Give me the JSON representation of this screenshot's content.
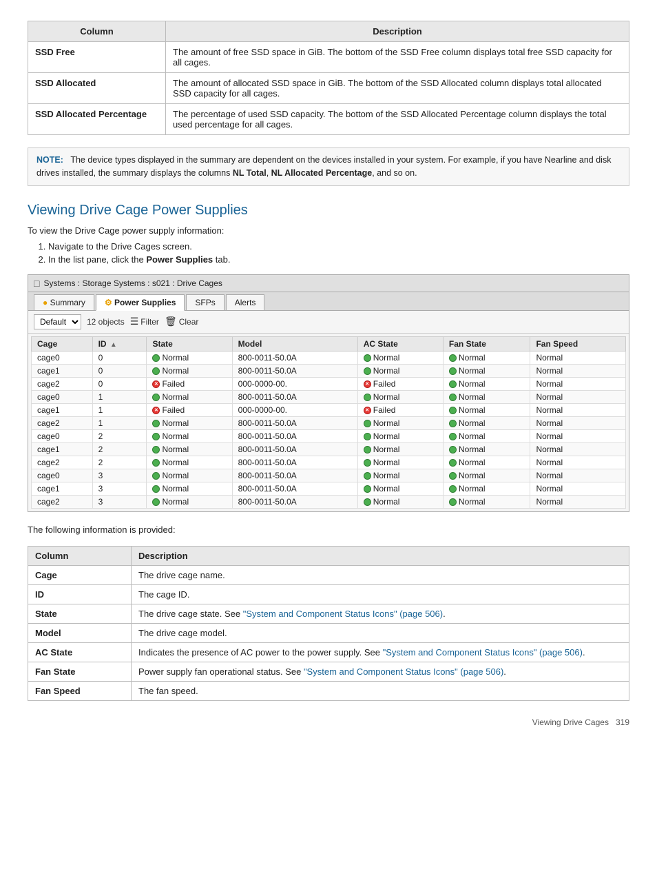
{
  "top_table": {
    "headers": [
      "Column",
      "Description"
    ],
    "rows": [
      {
        "column": "SSD Free",
        "description": "The amount of free SSD space in GiB. The bottom of the SSD Free column displays total free SSD capacity for all cages."
      },
      {
        "column": "SSD Allocated",
        "description": "The amount of allocated SSD space in GiB. The bottom of the SSD Allocated column displays total allocated SSD capacity for all cages."
      },
      {
        "column": "SSD Allocated Percentage",
        "description": "The percentage of used SSD capacity. The bottom of the SSD Allocated Percentage column displays the total used percentage for all cages."
      }
    ]
  },
  "note": {
    "label": "NOTE:",
    "text": "The device types displayed in the summary are dependent on the devices installed in your system. For example, if you have Nearline and disk drives installed, the summary displays the columns NL Total, NL Allocated Percentage, and so on."
  },
  "section": {
    "heading": "Viewing Drive Cage Power Supplies",
    "intro": "To view the Drive Cage power supply information:",
    "steps": [
      "Navigate to the Drive Cages screen.",
      "In the list pane, click the Power Supplies tab."
    ]
  },
  "ui": {
    "titlebar": "Systems : Storage Systems : s021 : Drive Cages",
    "tabs": [
      "Summary",
      "Power Supplies",
      "SFPs",
      "Alerts"
    ],
    "active_tab": "Power Supplies",
    "toolbar": {
      "dropdown_value": "Default",
      "objects_count": "12 objects",
      "filter_label": "Filter",
      "clear_label": "Clear"
    },
    "table_headers": [
      "Cage",
      "ID",
      "State",
      "Model",
      "AC State",
      "Fan State",
      "Fan Speed"
    ],
    "rows": [
      {
        "cage": "cage0",
        "id": "0",
        "state": "Normal",
        "state_type": "normal",
        "model": "800-0011-50.0A",
        "ac_state": "Normal",
        "ac_type": "normal",
        "fan_state": "Normal",
        "fan_type": "normal",
        "fan_speed": "Normal"
      },
      {
        "cage": "cage1",
        "id": "0",
        "state": "Normal",
        "state_type": "normal",
        "model": "800-0011-50.0A",
        "ac_state": "Normal",
        "ac_type": "normal",
        "fan_state": "Normal",
        "fan_type": "normal",
        "fan_speed": "Normal"
      },
      {
        "cage": "cage2",
        "id": "0",
        "state": "Failed",
        "state_type": "failed",
        "model": "000-0000-00.",
        "ac_state": "Failed",
        "ac_type": "failed",
        "fan_state": "Normal",
        "fan_type": "normal",
        "fan_speed": "Normal"
      },
      {
        "cage": "cage0",
        "id": "1",
        "state": "Normal",
        "state_type": "normal",
        "model": "800-0011-50.0A",
        "ac_state": "Normal",
        "ac_type": "normal",
        "fan_state": "Normal",
        "fan_type": "normal",
        "fan_speed": "Normal"
      },
      {
        "cage": "cage1",
        "id": "1",
        "state": "Failed",
        "state_type": "failed",
        "model": "000-0000-00.",
        "ac_state": "Failed",
        "ac_type": "failed",
        "fan_state": "Normal",
        "fan_type": "normal",
        "fan_speed": "Normal"
      },
      {
        "cage": "cage2",
        "id": "1",
        "state": "Normal",
        "state_type": "normal",
        "model": "800-0011-50.0A",
        "ac_state": "Normal",
        "ac_type": "normal",
        "fan_state": "Normal",
        "fan_type": "normal",
        "fan_speed": "Normal"
      },
      {
        "cage": "cage0",
        "id": "2",
        "state": "Normal",
        "state_type": "normal",
        "model": "800-0011-50.0A",
        "ac_state": "Normal",
        "ac_type": "normal",
        "fan_state": "Normal",
        "fan_type": "normal",
        "fan_speed": "Normal"
      },
      {
        "cage": "cage1",
        "id": "2",
        "state": "Normal",
        "state_type": "normal",
        "model": "800-0011-50.0A",
        "ac_state": "Normal",
        "ac_type": "normal",
        "fan_state": "Normal",
        "fan_type": "normal",
        "fan_speed": "Normal"
      },
      {
        "cage": "cage2",
        "id": "2",
        "state": "Normal",
        "state_type": "normal",
        "model": "800-0011-50.0A",
        "ac_state": "Normal",
        "ac_type": "normal",
        "fan_state": "Normal",
        "fan_type": "normal",
        "fan_speed": "Normal"
      },
      {
        "cage": "cage0",
        "id": "3",
        "state": "Normal",
        "state_type": "normal",
        "model": "800-0011-50.0A",
        "ac_state": "Normal",
        "ac_type": "normal",
        "fan_state": "Normal",
        "fan_type": "normal",
        "fan_speed": "Normal"
      },
      {
        "cage": "cage1",
        "id": "3",
        "state": "Normal",
        "state_type": "normal",
        "model": "800-0011-50.0A",
        "ac_state": "Normal",
        "ac_type": "normal",
        "fan_state": "Normal",
        "fan_type": "normal",
        "fan_speed": "Normal"
      },
      {
        "cage": "cage2",
        "id": "3",
        "state": "Normal",
        "state_type": "normal",
        "model": "800-0011-50.0A",
        "ac_state": "Normal",
        "ac_type": "normal",
        "fan_state": "Normal",
        "fan_type": "normal",
        "fan_speed": "Normal"
      }
    ]
  },
  "following_info_label": "The following information is provided:",
  "bottom_table": {
    "headers": [
      "Column",
      "Description"
    ],
    "rows": [
      {
        "column": "Cage",
        "description": "The drive cage name.",
        "link": null
      },
      {
        "column": "ID",
        "description": "The cage ID.",
        "link": null
      },
      {
        "column": "State",
        "description_prefix": "The drive cage state. See ",
        "link_text": "\"System and Component Status Icons\" (page 506)",
        "link_href": "#",
        "description_suffix": ".",
        "link": true
      },
      {
        "column": "Model",
        "description": "The drive cage model.",
        "link": null
      },
      {
        "column": "AC State",
        "description_prefix": "Indicates the presence of AC power to the power supply. See ",
        "link_text": "\"System and Component Status Icons\" (page 506)",
        "link_href": "#",
        "description_suffix": ".",
        "link": true
      },
      {
        "column": "Fan State",
        "description_prefix": "Power supply fan operational status. See ",
        "link_text": "\"System and Component Status Icons\" (page 506)",
        "link_href": "#",
        "description_suffix": ".",
        "link": true
      },
      {
        "column": "Fan Speed",
        "description": "The fan speed.",
        "link": null
      }
    ]
  },
  "footer": {
    "left": "Viewing Drive Cages",
    "right": "319"
  }
}
